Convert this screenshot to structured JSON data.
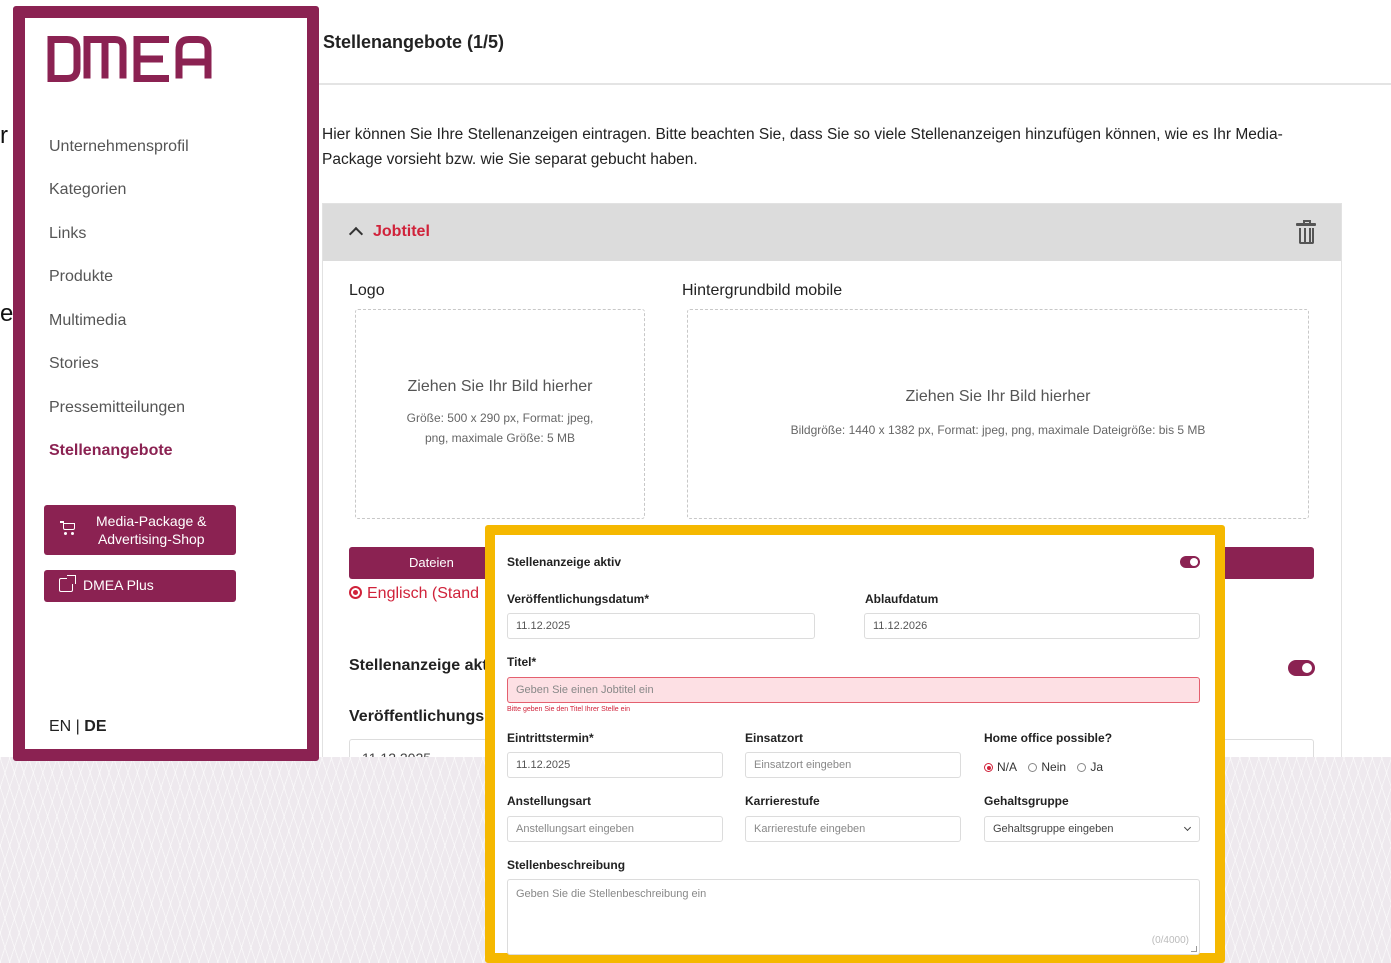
{
  "colors": {
    "brand": "#8b2252",
    "accent_red": "#d0223a",
    "highlight": "#f5b800"
  },
  "behind": {
    "glyph_1": "r",
    "glyph_2": "e"
  },
  "logo": {
    "text": "DMEA"
  },
  "sidebar": {
    "items": [
      {
        "label": "Unternehmensprofil"
      },
      {
        "label": "Kategorien"
      },
      {
        "label": "Links"
      },
      {
        "label": "Produkte"
      },
      {
        "label": "Multimedia"
      },
      {
        "label": "Stories"
      },
      {
        "label": "Pressemitteilungen"
      },
      {
        "label": "Stellenangebote",
        "active": true
      }
    ],
    "shop_button": {
      "line1": "Media-Package &",
      "line2": "Advertising-Shop",
      "icon": "cart-icon"
    },
    "plus_button": {
      "label": "DMEA Plus",
      "icon": "external-link-icon"
    },
    "lang": {
      "en": "EN",
      "sep": " | ",
      "de": "DE"
    }
  },
  "page": {
    "title": "Stellenangebote (1/5)",
    "intro": "Hier können Sie Ihre Stellenanzeigen eintragen. Bitte beachten Sie, dass Sie so viele Stellenanzeigen hinzufügen können, wie es Ihr Media-Package vorsieht bzw. wie Sie separat gebucht haben."
  },
  "card": {
    "title": "Jobtitel",
    "logo_label": "Logo",
    "logo_drop_title": "Ziehen Sie Ihr Bild hierher",
    "logo_drop_hint_1": "Größe: 500 x 290 px, Format: jpeg,",
    "logo_drop_hint_2": "png, maximale Größe: 5 MB",
    "bg_label": "Hintergrundbild mobile",
    "bg_drop_title": "Ziehen Sie Ihr Bild hierher",
    "bg_drop_hint": "Bildgröße: 1440 x 1382 px, Format: jpeg, png, maximale Dateigröße: bis 5 MB",
    "files_button": "Dateien",
    "lang_option": "Englisch (Stand",
    "active_label": "Stellenanzeige akt",
    "pub_label": "Veröffentlichungs",
    "pub_value": "11.12.2025"
  },
  "popup": {
    "active_label": "Stellenanzeige aktiv",
    "pub_date_label": "Veröffentlichungsdatum*",
    "pub_date_value": "11.12.2025",
    "expiry_label": "Ablaufdatum",
    "expiry_value": "11.12.2026",
    "title_label": "Titel*",
    "title_placeholder": "Geben Sie einen Jobtitel ein",
    "title_error": "Bitte geben Sie den Titel Ihrer Stelle ein",
    "start_label": "Eintrittstermin*",
    "start_value": "11.12.2025",
    "location_label": "Einsatzort",
    "location_placeholder": "Einsatzort eingeben",
    "homeoffice_label": "Home office possible?",
    "homeoffice_options": [
      "N/A",
      "Nein",
      "Ja"
    ],
    "employment_label": "Anstellungsart",
    "employment_placeholder": "Anstellungsart eingeben",
    "career_label": "Karrierestufe",
    "career_placeholder": "Karrierestufe eingeben",
    "salary_label": "Gehaltsgruppe",
    "salary_placeholder": "Gehaltsgruppe eingeben",
    "description_label": "Stellenbeschreibung",
    "description_placeholder": "Geben Sie die Stellenbeschreibung ein",
    "description_counter": "(0/4000)"
  }
}
